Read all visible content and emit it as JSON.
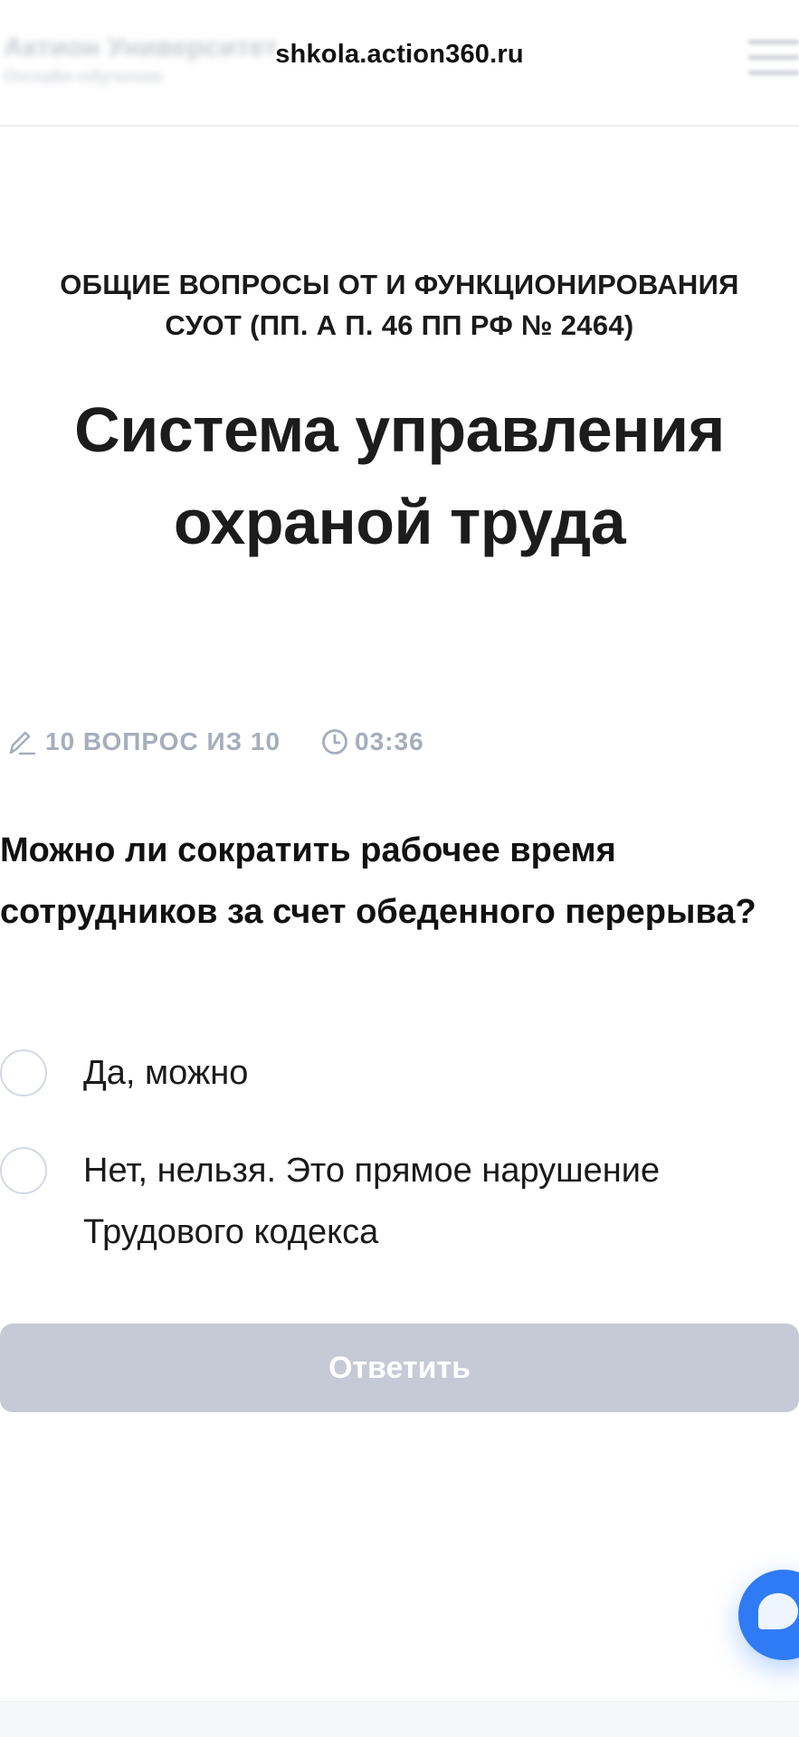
{
  "header": {
    "brand_name": "Актион Университет",
    "brand_sub": "Онлайн-обучение",
    "url": "shkola.action360.ru"
  },
  "section_label": "ОБЩИЕ ВОПРОСЫ ОТ И ФУНКЦИОНИРОВАНИЯ СУОТ (ПП. А П. 46 ПП РФ № 2464)",
  "page_title": "Система управления охраной труда",
  "quiz": {
    "progress_text": "10 ВОПРОС ИЗ 10",
    "current_question": 10,
    "total_questions": 10,
    "timer": "03:36",
    "question": "Можно ли сократить рабочее время сотрудников за счет обеденного перерыва?",
    "answers": [
      {
        "label": "Да, можно",
        "selected": false
      },
      {
        "label": "Нет, нельзя. Это прямое нарушение Трудового кодекса",
        "selected": false
      }
    ],
    "submit_label": "Ответить"
  },
  "colors": {
    "accent": "#2f7bf5",
    "submit_disabled": "#c5cad6",
    "meta_text": "#a6adbb",
    "radio_border": "#d3d8e2"
  },
  "icons": [
    "menu-icon",
    "pencil-icon",
    "clock-icon",
    "chat-icon"
  ]
}
